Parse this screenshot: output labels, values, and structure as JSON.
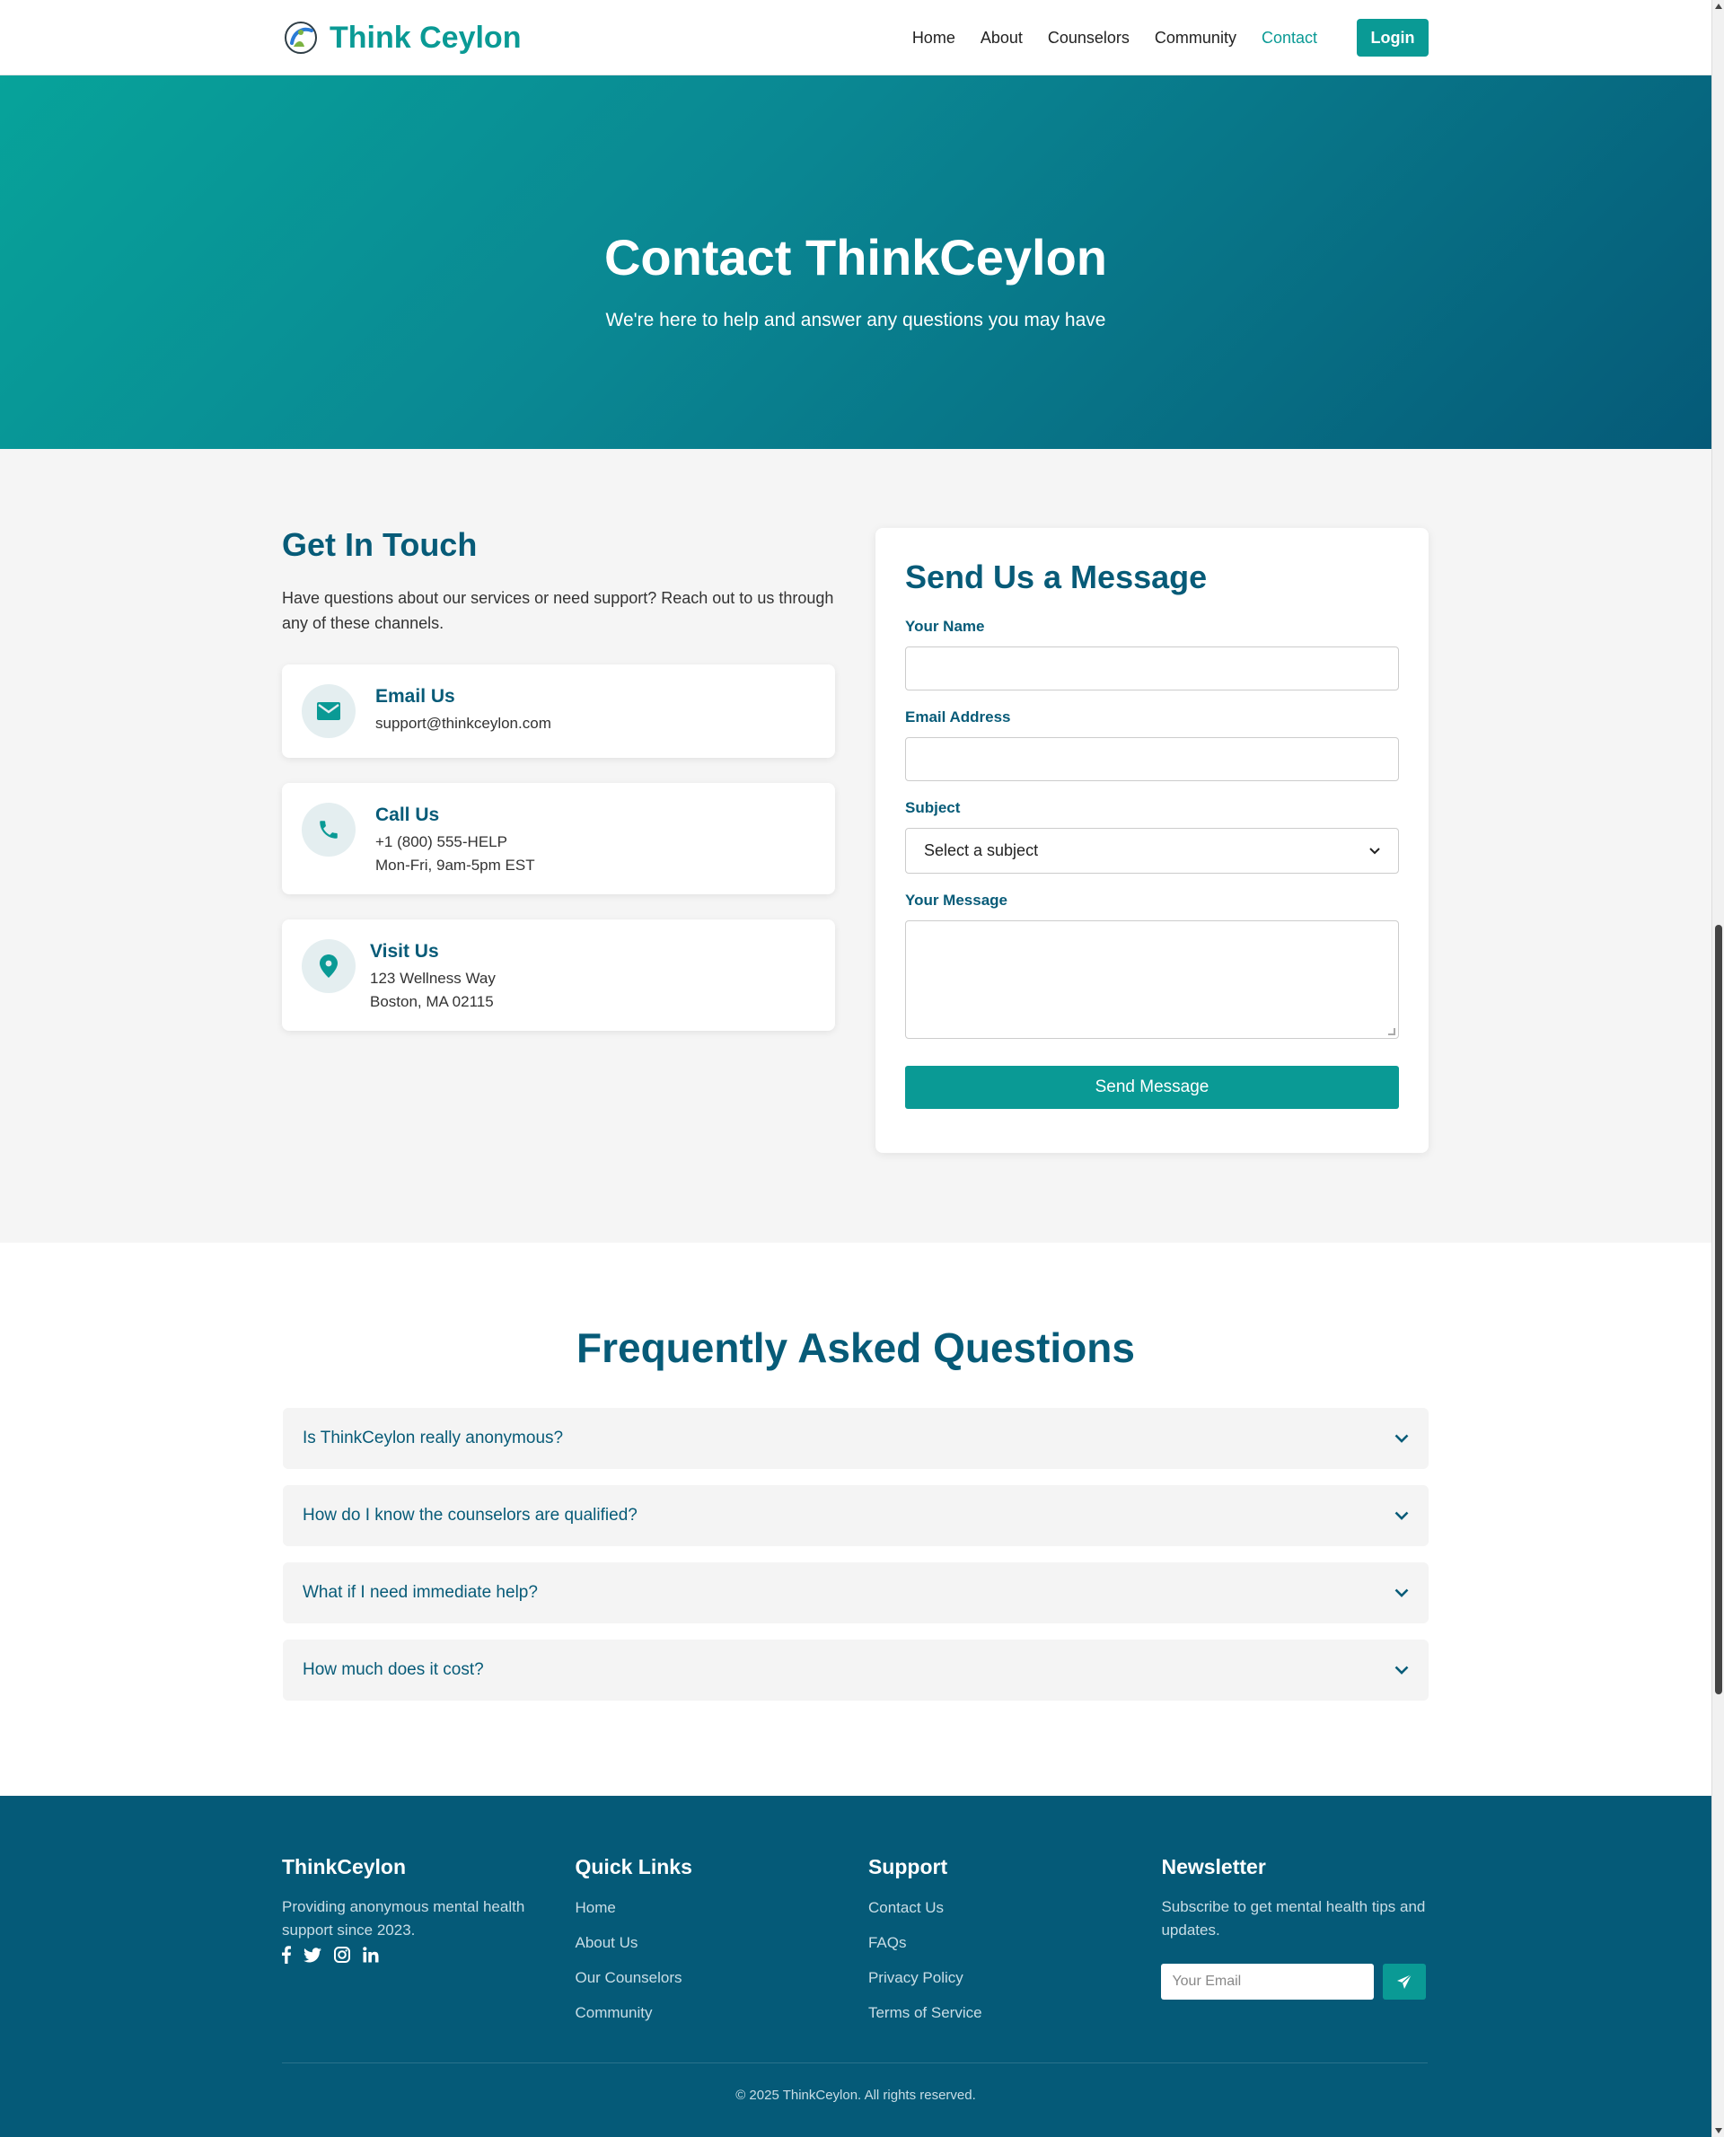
{
  "brand": {
    "name": "Think Ceylon"
  },
  "nav": {
    "items": [
      {
        "label": "Home",
        "active": false
      },
      {
        "label": "About",
        "active": false
      },
      {
        "label": "Counselors",
        "active": false
      },
      {
        "label": "Community",
        "active": false
      },
      {
        "label": "Contact",
        "active": true
      }
    ],
    "login_label": "Login"
  },
  "hero": {
    "title": "Contact ThinkCeylon",
    "subtitle": "We're here to help and answer any questions you may have"
  },
  "contact": {
    "heading": "Get In Touch",
    "intro": "Have questions about our services or need support? Reach out to us through any of these channels.",
    "cards": [
      {
        "icon": "envelope-icon",
        "title": "Email Us",
        "lines": [
          "support@thinkceylon.com"
        ]
      },
      {
        "icon": "phone-icon",
        "title": "Call Us",
        "lines": [
          "+1 (800) 555-HELP",
          "Mon-Fri, 9am-5pm EST"
        ]
      },
      {
        "icon": "map-pin-icon",
        "title": "Visit Us",
        "lines": [
          "123 Wellness Way",
          "Boston, MA 02115"
        ]
      }
    ]
  },
  "form": {
    "heading": "Send Us a Message",
    "name_label": "Your Name",
    "name_value": "",
    "email_label": "Email Address",
    "email_value": "",
    "subject_label": "Subject",
    "subject_selected": "Select a subject",
    "message_label": "Your Message",
    "message_value": "",
    "submit_label": "Send Message"
  },
  "faq": {
    "heading": "Frequently Asked Questions",
    "items": [
      {
        "question": "Is ThinkCeylon really anonymous?"
      },
      {
        "question": "How do I know the counselors are qualified?"
      },
      {
        "question": "What if I need immediate help?"
      },
      {
        "question": "How much does it cost?"
      }
    ]
  },
  "footer": {
    "about": {
      "title": "ThinkCeylon",
      "desc": "Providing anonymous mental health support since 2023.",
      "socials": [
        "facebook-icon",
        "twitter-icon",
        "instagram-icon",
        "linkedin-icon"
      ]
    },
    "quick_links": {
      "title": "Quick Links",
      "links": [
        "Home",
        "About Us",
        "Our Counselors",
        "Community"
      ]
    },
    "support": {
      "title": "Support",
      "links": [
        "Contact Us",
        "FAQs",
        "Privacy Policy",
        "Terms of Service"
      ]
    },
    "newsletter": {
      "title": "Newsletter",
      "desc": "Subscribe to get mental health tips and updates.",
      "placeholder": "Your Email"
    },
    "copyright": "© 2025 ThinkCeylon. All rights reserved."
  },
  "colors": {
    "accent": "#0a9a95",
    "primary_dark": "#075b78",
    "footer_bg": "#055a78",
    "section_bg": "#f5f5f5"
  }
}
